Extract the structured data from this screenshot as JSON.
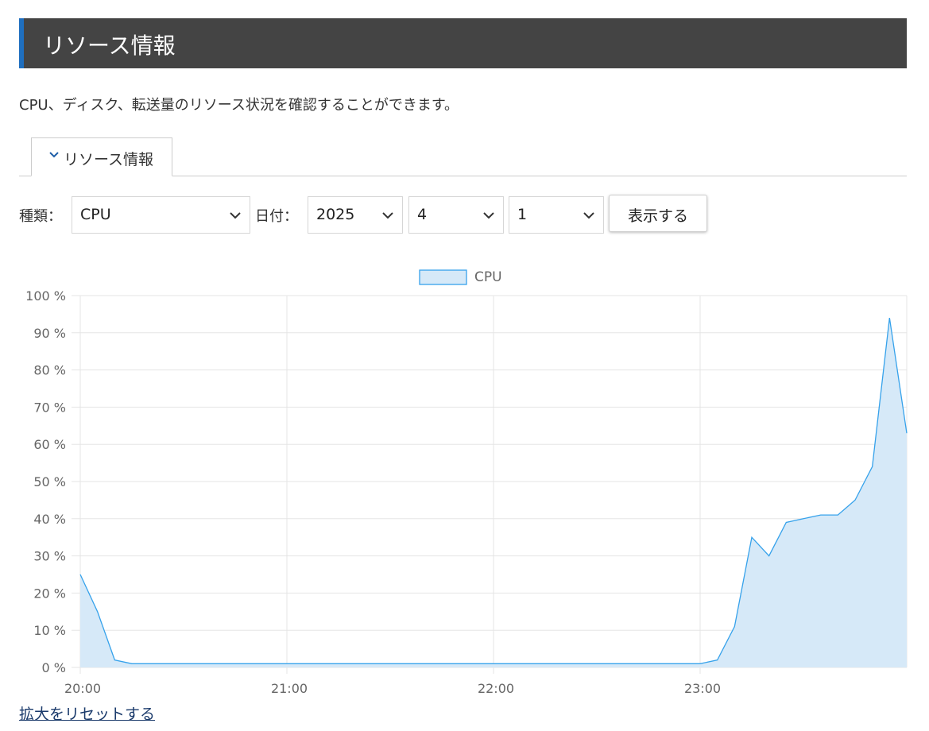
{
  "header": {
    "title": "リソース情報"
  },
  "description": "CPU、ディスク、転送量のリソース状況を確認することができます。",
  "tab": {
    "label": "リソース情報",
    "icon": "chevron-down-icon"
  },
  "form": {
    "type_label": "種類：",
    "type_value": "CPU",
    "date_label": "日付：",
    "year_value": "2025",
    "month_value": "4",
    "day_value": "1",
    "show_button": "表示する"
  },
  "chart_data": {
    "type": "area",
    "title": "",
    "legend": {
      "position": "top-center",
      "entries": [
        "CPU"
      ]
    },
    "series": [
      {
        "name": "CPU",
        "color": "#36a2eb",
        "fill": "#d6e9f8",
        "x": [
          "20:00",
          "20:05",
          "20:10",
          "20:15",
          "20:20",
          "20:25",
          "20:30",
          "20:35",
          "20:40",
          "20:45",
          "20:50",
          "20:55",
          "21:00",
          "21:05",
          "21:10",
          "21:15",
          "21:20",
          "21:25",
          "21:30",
          "21:35",
          "21:40",
          "21:45",
          "21:50",
          "21:55",
          "22:00",
          "22:05",
          "22:10",
          "22:15",
          "22:20",
          "22:25",
          "22:30",
          "22:35",
          "22:40",
          "22:45",
          "22:50",
          "22:55",
          "23:00",
          "23:05",
          "23:10",
          "23:15",
          "23:20",
          "23:25",
          "23:30",
          "23:35",
          "23:40",
          "23:45",
          "23:50",
          "23:55",
          "24:00"
        ],
        "values": [
          25,
          15,
          2,
          1,
          1,
          1,
          1,
          1,
          1,
          1,
          1,
          1,
          1,
          1,
          1,
          1,
          1,
          1,
          1,
          1,
          1,
          1,
          1,
          1,
          1,
          1,
          1,
          1,
          1,
          1,
          1,
          1,
          1,
          1,
          1,
          1,
          1,
          2,
          11,
          35,
          30,
          39,
          40,
          41,
          41,
          45,
          54,
          94,
          63
        ]
      }
    ],
    "x_ticks": [
      "20:00",
      "21:00",
      "22:00",
      "23:00"
    ],
    "y_ticks": [
      "0 %",
      "10 %",
      "20 %",
      "30 %",
      "40 %",
      "50 %",
      "60 %",
      "70 %",
      "80 %",
      "90 %",
      "100 %"
    ],
    "ylim": [
      0,
      100
    ],
    "grid": true
  },
  "reset_link": "拡大をリセットする"
}
